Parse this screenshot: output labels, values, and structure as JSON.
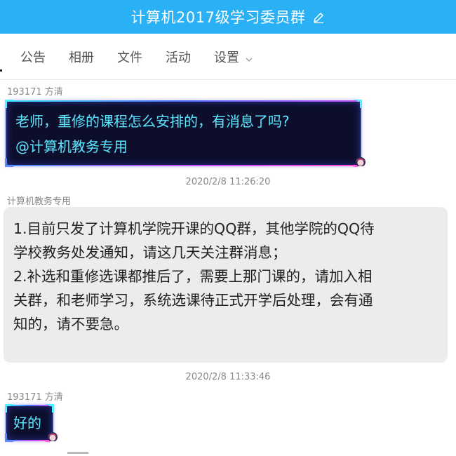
{
  "header": {
    "title": "计算机2017级学习委员群",
    "edit_icon": "pencil-icon",
    "bg_color": "#2ab0f5"
  },
  "tabs": [
    {
      "label": "公告"
    },
    {
      "label": "相册"
    },
    {
      "label": "文件"
    },
    {
      "label": "活动"
    },
    {
      "label": "设置"
    }
  ],
  "messages": [
    {
      "sender": "193171 方清",
      "lines": [
        "老师，重修的课程怎么安排的，有消息了吗?",
        "@计算机教务专用"
      ]
    },
    {
      "timestamp": "2020/2/8 11:26:20",
      "sender": "计算机教务专用",
      "lines": [
        "1.目前只发了计算机学院开课的QQ群，其他学院的QQ待",
        "学校教务处发通知，请这几天关注群消息；",
        "2.补选和重修选课都推后了，需要上那门课的，请加入相",
        "关群，和老师学习，系统选课待正式开学后处理，会有通",
        "知的，请不要急。"
      ]
    },
    {
      "timestamp": "2020/2/8 11:33:46",
      "sender": "193171 方清",
      "lines": [
        "好的"
      ]
    }
  ],
  "colors": {
    "neon_text": "#5ce8ff",
    "neon_bg": "#0d0e2c",
    "gray_bubble": "#ececec"
  }
}
